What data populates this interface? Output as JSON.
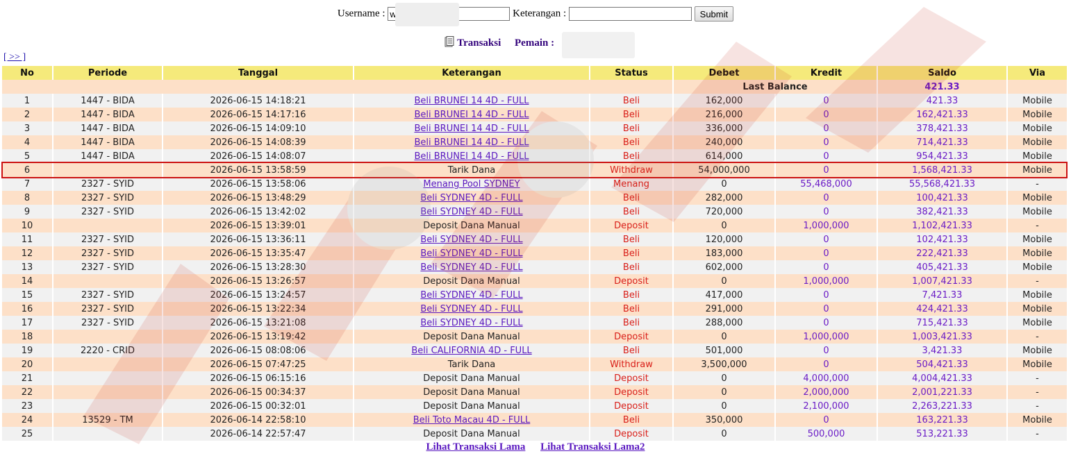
{
  "form": {
    "username_label": "Username :",
    "username_value": "w",
    "keterangan_label": "Keterangan :",
    "keterangan_value": "",
    "submit_label": "Submit"
  },
  "subtitle": {
    "transaksi_label": "Transaksi",
    "pemain_label": "Pemain :",
    "icon": "document-icon"
  },
  "nav": {
    "next_label": "[ >> ]"
  },
  "table": {
    "headers": [
      "No",
      "Periode",
      "Tanggal",
      "Keterangan",
      "Status",
      "Debet",
      "Kredit",
      "Saldo",
      "Via"
    ],
    "last_balance_label": "Last Balance",
    "last_balance_value": "421.33",
    "highlighted_row": 6,
    "rows": [
      {
        "no": "1",
        "periode": "1447 - BIDA",
        "tanggal": "2026-06-15 14:18:21",
        "keterangan": "Beli BRUNEI 14 4D - FULL",
        "link": true,
        "status": "Beli",
        "debet": "162,000",
        "kredit": "0",
        "saldo": "421.33",
        "via": "Mobile"
      },
      {
        "no": "2",
        "periode": "1447 - BIDA",
        "tanggal": "2026-06-15 14:17:16",
        "keterangan": "Beli BRUNEI 14 4D - FULL",
        "link": true,
        "status": "Beli",
        "debet": "216,000",
        "kredit": "0",
        "saldo": "162,421.33",
        "via": "Mobile"
      },
      {
        "no": "3",
        "periode": "1447 - BIDA",
        "tanggal": "2026-06-15 14:09:10",
        "keterangan": "Beli BRUNEI 14 4D - FULL",
        "link": true,
        "status": "Beli",
        "debet": "336,000",
        "kredit": "0",
        "saldo": "378,421.33",
        "via": "Mobile"
      },
      {
        "no": "4",
        "periode": "1447 - BIDA",
        "tanggal": "2026-06-15 14:08:39",
        "keterangan": "Beli BRUNEI 14 4D - FULL",
        "link": true,
        "status": "Beli",
        "debet": "240,000",
        "kredit": "0",
        "saldo": "714,421.33",
        "via": "Mobile"
      },
      {
        "no": "5",
        "periode": "1447 - BIDA",
        "tanggal": "2026-06-15 14:08:07",
        "keterangan": "Beli BRUNEI 14 4D - FULL",
        "link": true,
        "status": "Beli",
        "debet": "614,000",
        "kredit": "0",
        "saldo": "954,421.33",
        "via": "Mobile"
      },
      {
        "no": "6",
        "periode": "",
        "tanggal": "2026-06-15 13:58:59",
        "keterangan": "Tarik Dana",
        "link": false,
        "status": "Withdraw",
        "debet": "54,000,000",
        "kredit": "0",
        "saldo": "1,568,421.33",
        "via": "Mobile"
      },
      {
        "no": "7",
        "periode": "2327 - SYID",
        "tanggal": "2026-06-15 13:58:06",
        "keterangan": "Menang Pool SYDNEY",
        "link": true,
        "status": "Menang",
        "debet": "0",
        "kredit": "55,468,000",
        "saldo": "55,568,421.33",
        "via": "-"
      },
      {
        "no": "8",
        "periode": "2327 - SYID",
        "tanggal": "2026-06-15 13:48:29",
        "keterangan": "Beli SYDNEY 4D - FULL",
        "link": true,
        "status": "Beli",
        "debet": "282,000",
        "kredit": "0",
        "saldo": "100,421.33",
        "via": "Mobile"
      },
      {
        "no": "9",
        "periode": "2327 - SYID",
        "tanggal": "2026-06-15 13:42:02",
        "keterangan": "Beli SYDNEY 4D - FULL",
        "link": true,
        "status": "Beli",
        "debet": "720,000",
        "kredit": "0",
        "saldo": "382,421.33",
        "via": "Mobile"
      },
      {
        "no": "10",
        "periode": "",
        "tanggal": "2026-06-15 13:39:01",
        "keterangan": "Deposit Dana Manual",
        "link": false,
        "status": "Deposit",
        "debet": "0",
        "kredit": "1,000,000",
        "saldo": "1,102,421.33",
        "via": "-"
      },
      {
        "no": "11",
        "periode": "2327 - SYID",
        "tanggal": "2026-06-15 13:36:11",
        "keterangan": "Beli SYDNEY 4D - FULL",
        "link": true,
        "status": "Beli",
        "debet": "120,000",
        "kredit": "0",
        "saldo": "102,421.33",
        "via": "Mobile"
      },
      {
        "no": "12",
        "periode": "2327 - SYID",
        "tanggal": "2026-06-15 13:35:47",
        "keterangan": "Beli SYDNEY 4D - FULL",
        "link": true,
        "status": "Beli",
        "debet": "183,000",
        "kredit": "0",
        "saldo": "222,421.33",
        "via": "Mobile"
      },
      {
        "no": "13",
        "periode": "2327 - SYID",
        "tanggal": "2026-06-15 13:28:30",
        "keterangan": "Beli SYDNEY 4D - FULL",
        "link": true,
        "status": "Beli",
        "debet": "602,000",
        "kredit": "0",
        "saldo": "405,421.33",
        "via": "Mobile"
      },
      {
        "no": "14",
        "periode": "",
        "tanggal": "2026-06-15 13:26:57",
        "keterangan": "Deposit Dana Manual",
        "link": false,
        "status": "Deposit",
        "debet": "0",
        "kredit": "1,000,000",
        "saldo": "1,007,421.33",
        "via": "-"
      },
      {
        "no": "15",
        "periode": "2327 - SYID",
        "tanggal": "2026-06-15 13:24:57",
        "keterangan": "Beli SYDNEY 4D - FULL",
        "link": true,
        "status": "Beli",
        "debet": "417,000",
        "kredit": "0",
        "saldo": "7,421.33",
        "via": "Mobile"
      },
      {
        "no": "16",
        "periode": "2327 - SYID",
        "tanggal": "2026-06-15 13:22:34",
        "keterangan": "Beli SYDNEY 4D - FULL",
        "link": true,
        "status": "Beli",
        "debet": "291,000",
        "kredit": "0",
        "saldo": "424,421.33",
        "via": "Mobile"
      },
      {
        "no": "17",
        "periode": "2327 - SYID",
        "tanggal": "2026-06-15 13:21:08",
        "keterangan": "Beli SYDNEY 4D - FULL",
        "link": true,
        "status": "Beli",
        "debet": "288,000",
        "kredit": "0",
        "saldo": "715,421.33",
        "via": "Mobile"
      },
      {
        "no": "18",
        "periode": "",
        "tanggal": "2026-06-15 13:19:42",
        "keterangan": "Deposit Dana Manual",
        "link": false,
        "status": "Deposit",
        "debet": "0",
        "kredit": "1,000,000",
        "saldo": "1,003,421.33",
        "via": "-"
      },
      {
        "no": "19",
        "periode": "2220 - CRID",
        "tanggal": "2026-06-15 08:08:06",
        "keterangan": "Beli CALIFORNIA 4D - FULL",
        "link": true,
        "status": "Beli",
        "debet": "501,000",
        "kredit": "0",
        "saldo": "3,421.33",
        "via": "Mobile"
      },
      {
        "no": "20",
        "periode": "",
        "tanggal": "2026-06-15 07:47:25",
        "keterangan": "Tarik Dana",
        "link": false,
        "status": "Withdraw",
        "debet": "3,500,000",
        "kredit": "0",
        "saldo": "504,421.33",
        "via": "Mobile"
      },
      {
        "no": "21",
        "periode": "",
        "tanggal": "2026-06-15 06:15:16",
        "keterangan": "Deposit Dana Manual",
        "link": false,
        "status": "Deposit",
        "debet": "0",
        "kredit": "4,000,000",
        "saldo": "4,004,421.33",
        "via": "-"
      },
      {
        "no": "22",
        "periode": "",
        "tanggal": "2026-06-15 00:34:37",
        "keterangan": "Deposit Dana Manual",
        "link": false,
        "status": "Deposit",
        "debet": "0",
        "kredit": "2,000,000",
        "saldo": "2,001,221.33",
        "via": "-"
      },
      {
        "no": "23",
        "periode": "",
        "tanggal": "2026-06-15 00:32:01",
        "keterangan": "Deposit Dana Manual",
        "link": false,
        "status": "Deposit",
        "debet": "0",
        "kredit": "2,100,000",
        "saldo": "2,263,221.33",
        "via": "-"
      },
      {
        "no": "24",
        "periode": "13529 - TM",
        "tanggal": "2026-06-14 22:58:10",
        "keterangan": "Beli Toto Macau 4D - FULL",
        "link": true,
        "status": "Beli",
        "debet": "350,000",
        "kredit": "0",
        "saldo": "163,221.33",
        "via": "Mobile"
      },
      {
        "no": "25",
        "periode": "",
        "tanggal": "2026-06-14 22:57:47",
        "keterangan": "Deposit Dana Manual",
        "link": false,
        "status": "Deposit",
        "debet": "0",
        "kredit": "500,000",
        "saldo": "513,221.33",
        "via": "-"
      }
    ]
  },
  "bottom_links": [
    "Lihat Transaksi Lama",
    "Lihat Transaksi Lama2"
  ],
  "colors": {
    "header_bg": "#f5ea7b",
    "row_odd": "#f1f1f1",
    "row_even": "#fde0c8",
    "status_red": "#d91e18",
    "purple": "#6a1bc6",
    "highlight_border": "#cc1111"
  }
}
